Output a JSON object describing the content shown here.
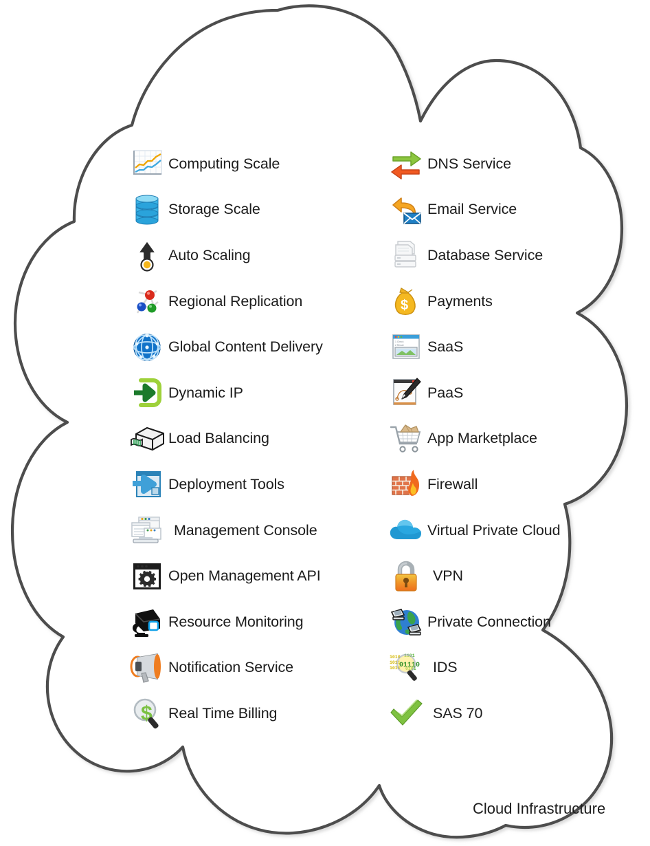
{
  "diagram": {
    "title": "Cloud Infrastructure",
    "shape": "cloud",
    "outline_color": "#4d4d4d",
    "fill_color": "#ffffff",
    "background_color": "#ffffff",
    "label_color": "#1c1c1c"
  },
  "caption": {
    "text": "Cloud Infrastructure"
  },
  "columns": {
    "left": {
      "items": [
        {
          "label": "Computing Scale",
          "icon": "line-chart-icon"
        },
        {
          "label": "Storage Scale",
          "icon": "database-stack-icon"
        },
        {
          "label": "Auto Scaling",
          "icon": "up-arrow-gauge-icon"
        },
        {
          "label": "Regional Replication",
          "icon": "network-nodes-icon"
        },
        {
          "label": "Global Content Delivery",
          "icon": "globe-network-icon"
        },
        {
          "label": "Dynamic IP",
          "icon": "green-arrow-into-box-icon"
        },
        {
          "label": "Load Balancing",
          "icon": "load-balancer-device-icon"
        },
        {
          "label": "Deployment Tools",
          "icon": "blue-window-arrow-icon"
        },
        {
          "label": "Management Console",
          "icon": "console-windows-icon"
        },
        {
          "label": "Open Management API",
          "icon": "window-gear-icon"
        },
        {
          "label": "Resource Monitoring",
          "icon": "security-camera-icon"
        },
        {
          "label": "Notification Service",
          "icon": "megaphone-icon"
        },
        {
          "label": "Real Time Billing",
          "icon": "dollar-magnifier-icon"
        }
      ]
    },
    "right": {
      "items": [
        {
          "label": "DNS Service",
          "icon": "two-way-arrows-icon"
        },
        {
          "label": "Email Service",
          "icon": "envelope-reply-arrow-icon"
        },
        {
          "label": "Database Service",
          "icon": "paper-stack-icon"
        },
        {
          "label": "Payments",
          "icon": "money-bag-icon"
        },
        {
          "label": "SaaS",
          "icon": "app-window-icon"
        },
        {
          "label": "PaaS",
          "icon": "window-pen-icon"
        },
        {
          "label": "App Marketplace",
          "icon": "shopping-cart-icon"
        },
        {
          "label": "Firewall",
          "icon": "firewall-flame-icon"
        },
        {
          "label": "Virtual Private Cloud",
          "icon": "blue-cloud-icon"
        },
        {
          "label": "VPN",
          "icon": "padlock-icon"
        },
        {
          "label": "Private Connection",
          "icon": "globe-computers-icon"
        },
        {
          "label": "IDS",
          "icon": "binary-magnifier-icon"
        },
        {
          "label": "SAS 70",
          "icon": "green-checkmark-icon"
        }
      ]
    }
  },
  "palette": {
    "orange": "#f08a20",
    "green": "#8cc63f",
    "blue": "#29abe2",
    "dark_gray": "#4d4d4d",
    "red_orange": "#e8481c",
    "yellow": "#f5c518"
  }
}
